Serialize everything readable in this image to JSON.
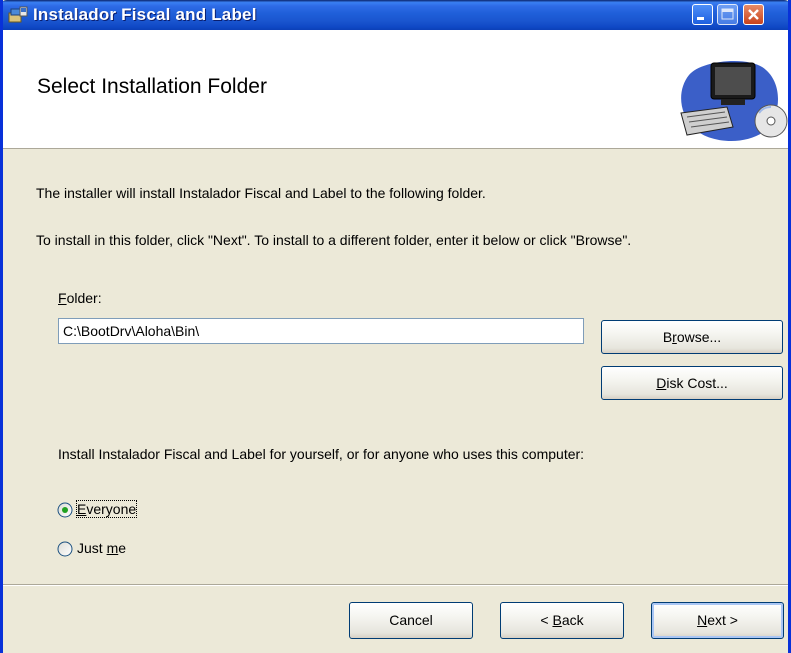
{
  "window": {
    "title": "Instalador Fiscal and Label"
  },
  "header": {
    "title": "Select Installation Folder"
  },
  "body": {
    "line1": "The installer will install Instalador Fiscal and Label to the following folder.",
    "line2": "To install in this folder, click \"Next\". To install to a different folder, enter it below or click \"Browse\".",
    "folder_label_mnemonic": "F",
    "folder_label_rest": "older:",
    "folder_value": "C:\\BootDrv\\Aloha\\Bin\\",
    "scope_question": "Install Instalador Fiscal and Label for yourself, or for anyone who uses this computer:"
  },
  "buttons": {
    "browse_pre": "B",
    "browse_mnemonic": "r",
    "browse_post": "owse...",
    "diskcost_mnemonic": "D",
    "diskcost_post": "isk Cost...",
    "cancel": "Cancel",
    "back_pre": "< ",
    "back_mnemonic": "B",
    "back_post": "ack",
    "next_mnemonic": "N",
    "next_post": "ext >"
  },
  "radios": {
    "everyone_mnemonic": "E",
    "everyone_post": "veryone",
    "everyone_selected": true,
    "justme_pre": "Just ",
    "justme_mnemonic": "m",
    "justme_post": "e",
    "justme_selected": false
  },
  "colors": {
    "titlebar_blue": "#0a58e6",
    "window_bg": "#ece9d8",
    "radio_dot": "#21a121"
  }
}
